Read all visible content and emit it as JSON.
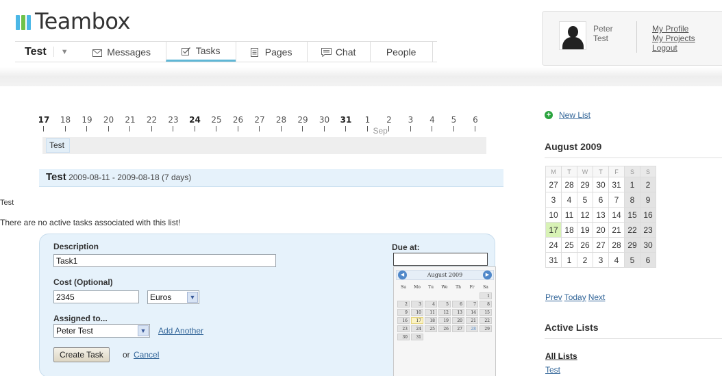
{
  "app": {
    "name": "Teambox",
    "logo_colors": [
      "#4bb7e6",
      "#6fc24a",
      "#4bb7e6"
    ]
  },
  "nav": {
    "project": "Test",
    "project_arrow": "▼",
    "tabs": [
      {
        "label": "Messages",
        "icon": "envelope-icon",
        "active": false
      },
      {
        "label": "Tasks",
        "icon": "checkbox-icon",
        "active": true
      },
      {
        "label": "Pages",
        "icon": "page-icon",
        "active": false
      },
      {
        "label": "Chat",
        "icon": "chat-icon",
        "active": false
      },
      {
        "label": "People",
        "icon": "",
        "active": false
      }
    ],
    "active_color": "#5fb7d6"
  },
  "user": {
    "first": "Peter",
    "last": "Test",
    "links": [
      "My Profile",
      "My Projects",
      "Logout"
    ]
  },
  "timeline": {
    "days": [
      "17",
      "18",
      "19",
      "20",
      "21",
      "22",
      "23",
      "24",
      "25",
      "26",
      "27",
      "28",
      "29",
      "30",
      "31",
      "1",
      "2",
      "3",
      "4",
      "5",
      "6"
    ],
    "bold_days": [
      "17",
      "24",
      "31"
    ],
    "month_label": "Sep",
    "item": "Test"
  },
  "task_list": {
    "name": "Test",
    "dates": "2009-08-11 - 2009-08-18 (7 days)",
    "description": "Test",
    "empty_message": "There are no active tasks associated with this list!"
  },
  "form": {
    "description_label": "Description",
    "description_value": "Task1",
    "cost_label": "Cost (Optional)",
    "cost_value": "2345",
    "currency": "Euros",
    "assigned_label": "Assigned to...",
    "assigned_value": "Peter Test",
    "add_another": "Add Another",
    "submit": "Create Task",
    "or_text": "or",
    "cancel": "Cancel",
    "due_label": "Due at:",
    "due_value": ""
  },
  "datepicker": {
    "title": "August 2009",
    "prev": "◀",
    "next": "▶",
    "day_headers": [
      "Su",
      "Mo",
      "Tu",
      "We",
      "Th",
      "Fr",
      "Sa"
    ],
    "cells": [
      "",
      "",
      "",
      "",
      "",
      "",
      "1",
      "2",
      "3",
      "4",
      "5",
      "6",
      "7",
      "8",
      "9",
      "10",
      "11",
      "12",
      "13",
      "14",
      "15",
      "16",
      "17",
      "18",
      "19",
      "20",
      "21",
      "22",
      "23",
      "24",
      "25",
      "26",
      "27",
      "28",
      "29",
      "30",
      "31"
    ],
    "today": "17",
    "selected": "28"
  },
  "sidebar": {
    "new_list": "New List",
    "calendar_title": "August 2009",
    "day_headers": [
      "M",
      "T",
      "W",
      "T",
      "F",
      "S",
      "S"
    ],
    "weeks": [
      [
        "27",
        "28",
        "29",
        "30",
        "31",
        "1",
        "2"
      ],
      [
        "3",
        "4",
        "5",
        "6",
        "7",
        "8",
        "9"
      ],
      [
        "10",
        "11",
        "12",
        "13",
        "14",
        "15",
        "16"
      ],
      [
        "17",
        "18",
        "19",
        "20",
        "21",
        "22",
        "23"
      ],
      [
        "24",
        "25",
        "26",
        "27",
        "28",
        "29",
        "30"
      ],
      [
        "31",
        "1",
        "2",
        "3",
        "4",
        "5",
        "6"
      ]
    ],
    "today": "17",
    "cal_nav": [
      "Prev",
      "Today",
      "Next"
    ],
    "active_lists_title": "Active Lists",
    "all_lists": "All Lists",
    "lists": [
      "Test"
    ]
  }
}
